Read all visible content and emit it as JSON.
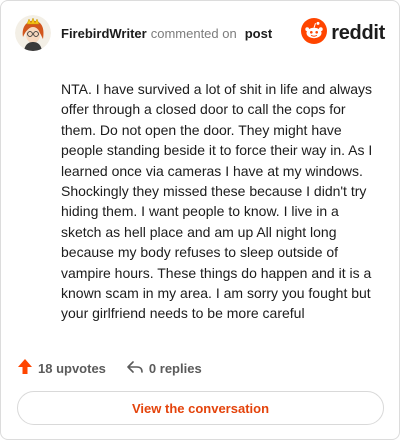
{
  "comment": {
    "author": "FirebirdWriter",
    "action_text": "commented on",
    "target": "post",
    "brand": "reddit",
    "body": "NTA. I have survived a lot of shit in life and always offer through a closed door to call the cops for them. Do not open the door. They might have people standing beside it to force their way in. As I learned once via cameras I have at my windows. Shockingly they missed these because I didn't try hiding them. I want people to know. I live in a sketch as hell place and am up All night long because my body refuses to sleep outside of vampire hours. These things do happen and it is a known scam in my area. I am sorry you fought but your girlfriend needs to be more careful"
  },
  "actions": {
    "upvotes": "18 upvotes",
    "replies": "0 replies"
  },
  "view_button": "View the conversation",
  "colors": {
    "brand_orange": "#ff4500",
    "button_text": "#e4430b"
  },
  "icons": {
    "upvote": "upvote-arrow-icon",
    "reply": "reply-arrow-icon",
    "brand": "reddit-snoo-icon"
  }
}
